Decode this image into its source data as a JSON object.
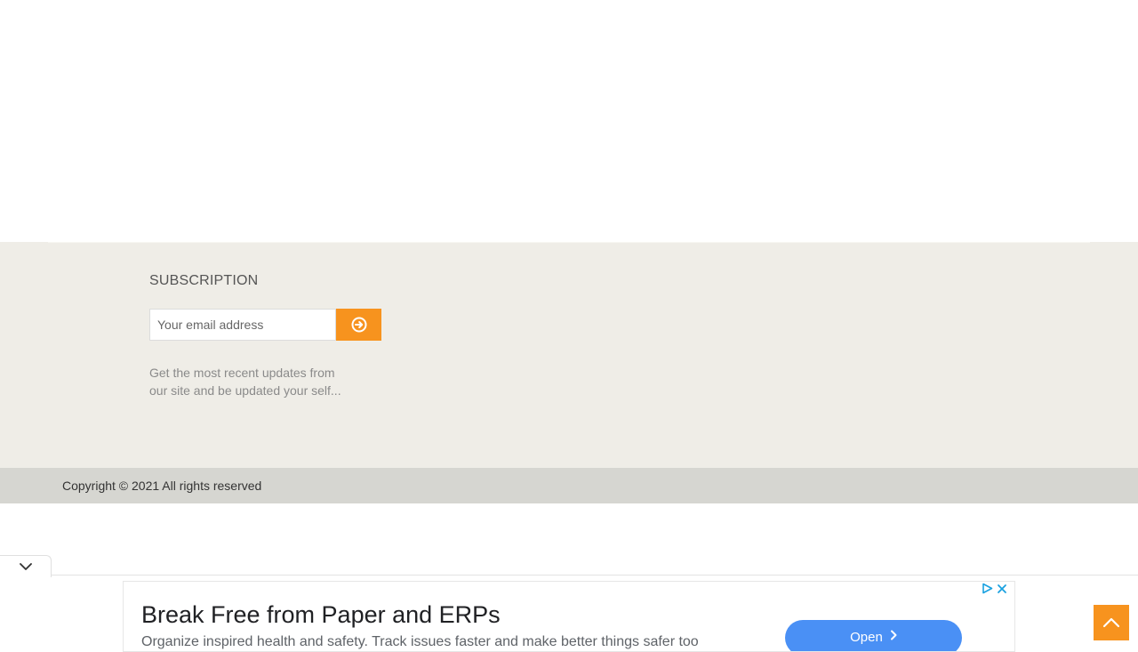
{
  "subscription": {
    "title": "SUBSCRIPTION",
    "email_placeholder": "Your email address",
    "submit_icon": "arrow-circle-right-icon",
    "description": "Get the most recent updates from our site and be updated your self..."
  },
  "footer": {
    "copyright": "Copyright © 2021 All rights reserved"
  },
  "ad": {
    "collapse_icon": "chevron-down-icon",
    "choices_icon": "adchoices-icon",
    "close_icon": "close-icon",
    "headline": "Break Free from Paper and ERPs",
    "body": "Organize inspired health and safety. Track issues faster and make better things safer too",
    "open_label": "Open"
  },
  "scroll_top": {
    "icon": "chevron-up-icon"
  },
  "colors": {
    "accent": "#f7931e",
    "footer_bg": "#efede7",
    "copyright_bg": "#d6d6d1",
    "ad_button": "#4a90f5"
  }
}
